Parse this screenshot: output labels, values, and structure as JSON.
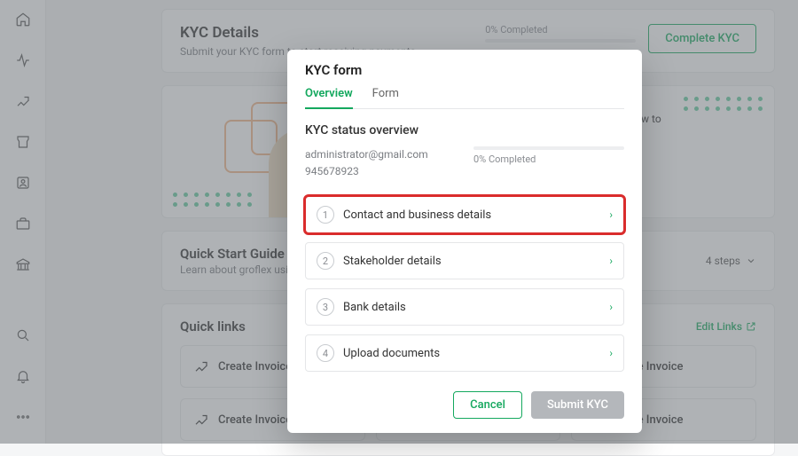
{
  "kyc_details": {
    "title": "KYC Details",
    "sub": "Submit your KYC form to start receiving payments",
    "progress_label": "0% Completed",
    "button": "Complete KYC"
  },
  "banner": {
    "hint": "earn how to"
  },
  "qsg": {
    "title": "Quick Start Guide",
    "sub": "Learn about groflex using quic",
    "steps_label": "4 steps"
  },
  "quicklinks": {
    "title": "Quick links",
    "edit": "Edit Links",
    "tile_label": "Create Invoice"
  },
  "modal": {
    "title": "KYC form",
    "tabs": {
      "overview": "Overview",
      "form": "Form"
    },
    "section_title": "KYC status overview",
    "email": "administrator@gmail.com",
    "phone": "945678923",
    "progress_label": "0% Completed",
    "steps": [
      {
        "n": "1",
        "label": "Contact and business details"
      },
      {
        "n": "2",
        "label": "Stakeholder details"
      },
      {
        "n": "3",
        "label": "Bank details"
      },
      {
        "n": "4",
        "label": "Upload documents"
      }
    ],
    "cancel": "Cancel",
    "submit": "Submit KYC"
  }
}
